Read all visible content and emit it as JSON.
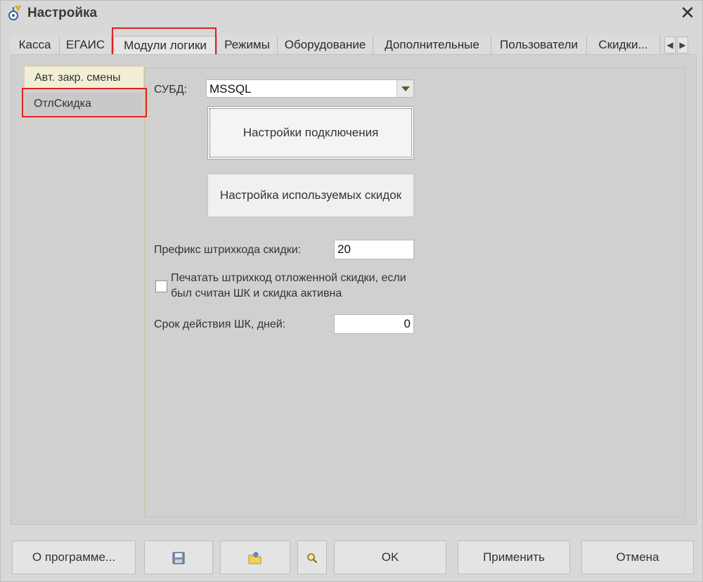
{
  "window": {
    "title": "Настройка",
    "close_glyph": "✕"
  },
  "tabs": [
    {
      "label": "Касса"
    },
    {
      "label": "ЕГАИС"
    },
    {
      "label": "Модули логики"
    },
    {
      "label": "Режимы"
    },
    {
      "label": "Оборудование"
    },
    {
      "label": "Дополнительные"
    },
    {
      "label": "Пользователи"
    },
    {
      "label": "Скидки..."
    }
  ],
  "active_tab": "Модули логики",
  "tab_scroll": {
    "left_glyph": "◀",
    "right_glyph": "▶"
  },
  "subpages": [
    {
      "label": "Авт. закр. смены"
    },
    {
      "label": "ОтлСкидка"
    }
  ],
  "active_subpage": "Авт. закр. смены",
  "form": {
    "dbms_label": "СУБД:",
    "dbms_value": "MSSQL",
    "connection_button": "Настройки подключения",
    "discounts_button": "Настройка используемых скидок",
    "prefix_label": "Префикс штрихкода скидки:",
    "prefix_value": "20",
    "print_checkbox_label_line1": "Печатать штрихкод отложенной скидки, если",
    "print_checkbox_label_line2": "был считан ШК и скидка активна",
    "print_checkbox_checked": false,
    "validity_label": "Срок действия ШК, дней:",
    "validity_value": "0"
  },
  "footer": {
    "about_button": "О программе...",
    "save_icon": "floppy-disk-icon",
    "open_icon": "folder-open-icon",
    "search_icon": "magnifier-icon",
    "ok_button": "OK",
    "apply_button": "Применить",
    "cancel_button": "Отмена"
  },
  "colors": {
    "highlight": "#e02020",
    "active_subpage_bg": "#f3efd6"
  }
}
